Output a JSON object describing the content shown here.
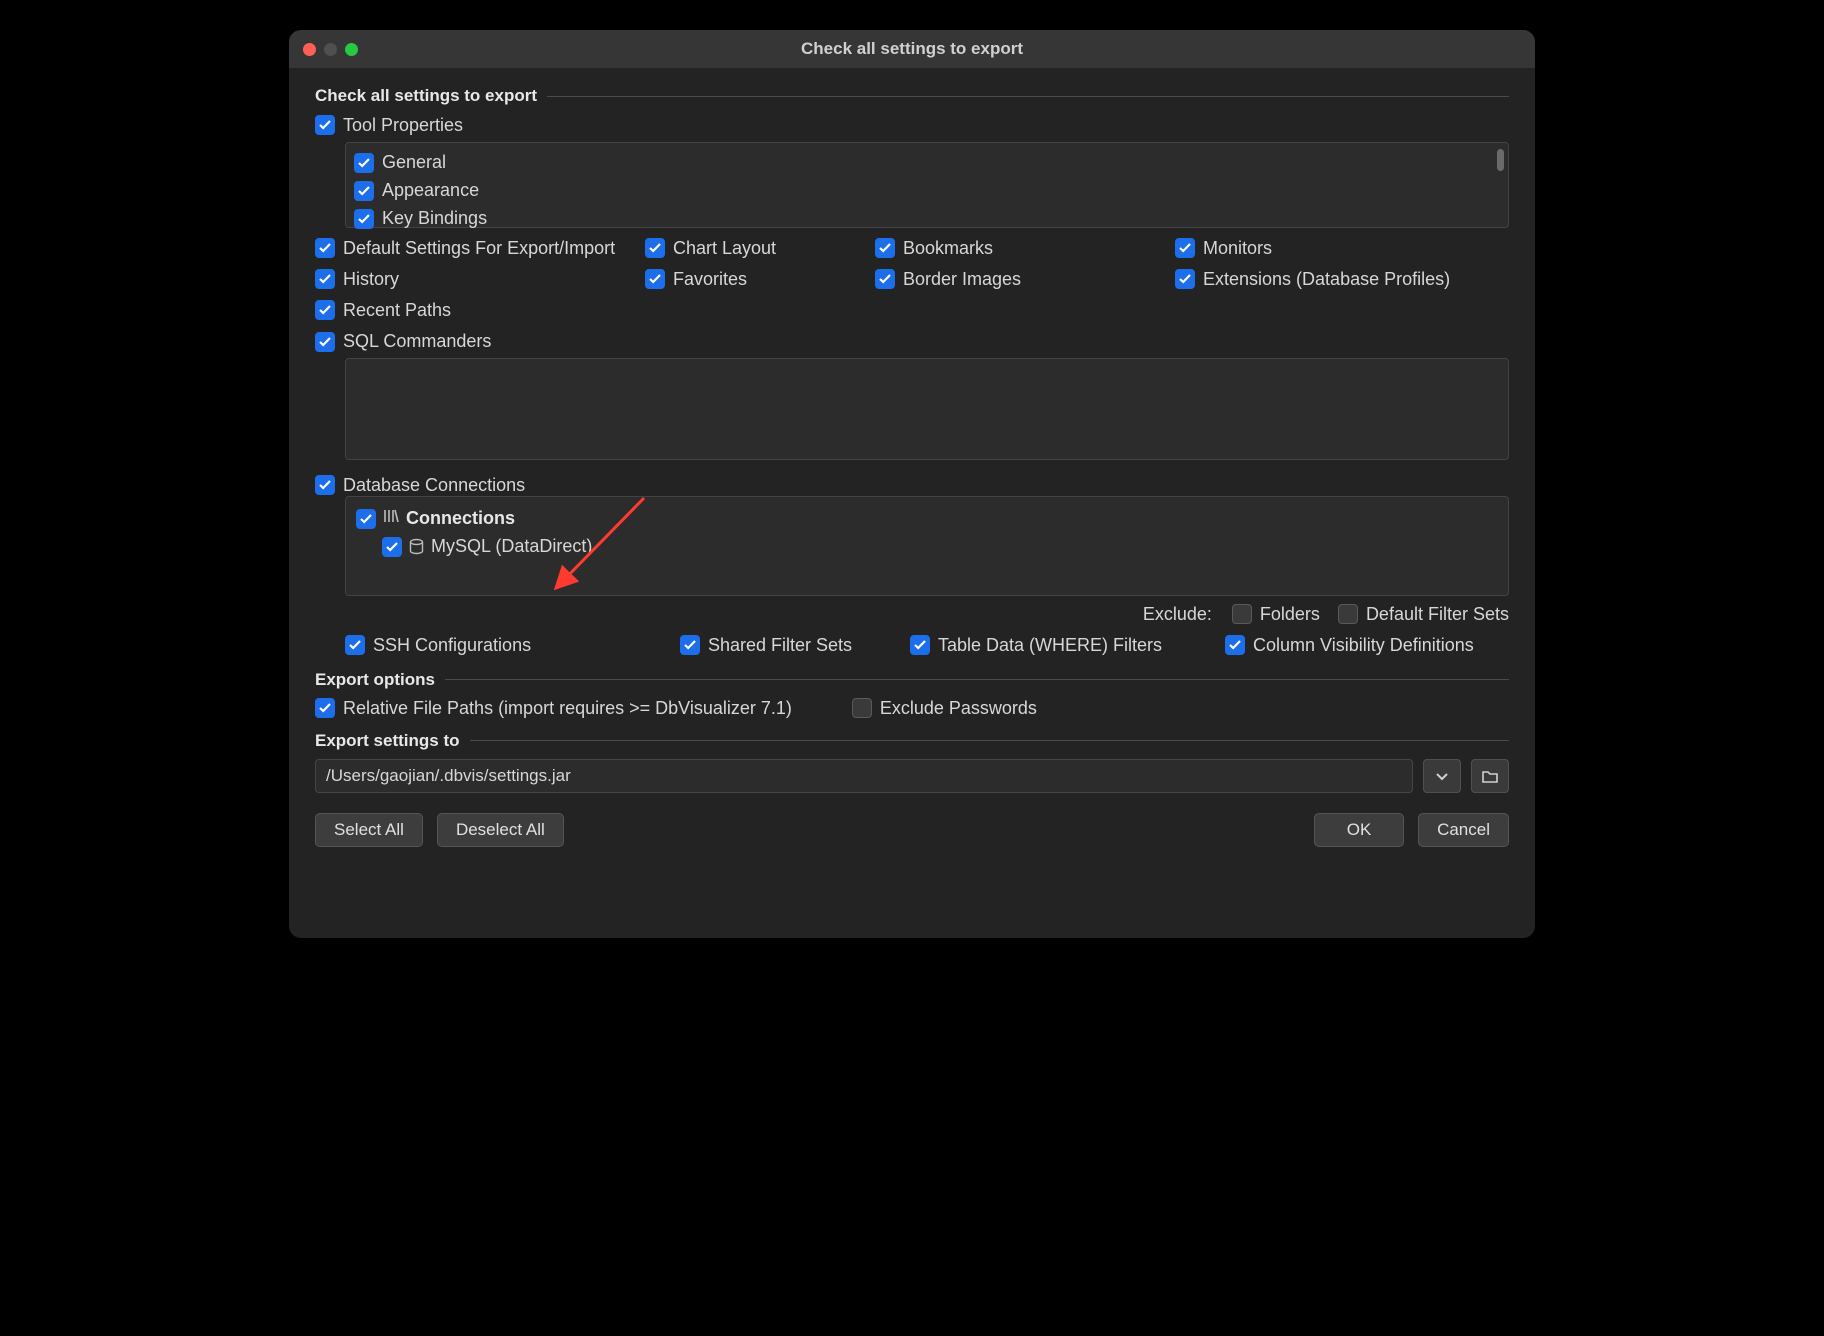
{
  "window": {
    "title": "Check all settings to export"
  },
  "section_check": {
    "legend": "Check all settings to export",
    "tool_properties": "Tool Properties",
    "tool_items": [
      "General",
      "Appearance",
      "Key Bindings"
    ],
    "grid": {
      "r1c1": "Default Settings For Export/Import",
      "r1c2": "Chart Layout",
      "r1c3": "Bookmarks",
      "r1c4": "Monitors",
      "r2c1": "History",
      "r2c2": "Favorites",
      "r2c3": "Border Images",
      "r2c4": "Extensions (Database Profiles)",
      "r3c1": "Recent Paths"
    },
    "sql_commanders": "SQL Commanders",
    "database_connections": "Database Connections",
    "connections_label": "Connections",
    "mysql_label": "MySQL (DataDirect)",
    "exclude_label": "Exclude:",
    "exclude_folders": "Folders",
    "exclude_filtersets": "Default Filter Sets",
    "ssh_row": {
      "c1": "SSH Configurations",
      "c2": "Shared Filter Sets",
      "c3": "Table Data (WHERE) Filters",
      "c4": "Column Visibility Definitions"
    }
  },
  "section_options": {
    "legend": "Export options",
    "relative_paths": "Relative File Paths (import requires >= DbVisualizer 7.1)",
    "exclude_passwords": "Exclude Passwords"
  },
  "section_export_to": {
    "legend": "Export settings to",
    "path": "/Users/gaojian/.dbvis/settings.jar"
  },
  "buttons": {
    "select_all": "Select All",
    "deselect_all": "Deselect All",
    "ok": "OK",
    "cancel": "Cancel"
  }
}
